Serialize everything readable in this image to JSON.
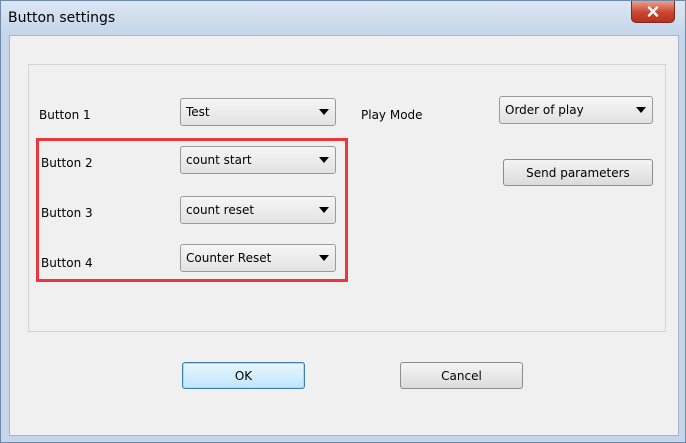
{
  "window": {
    "title": "Button settings",
    "close_label": "x"
  },
  "form": {
    "rows": [
      {
        "label": "Button 1",
        "selected": "Test"
      },
      {
        "label": "Button 2",
        "selected": "count start"
      },
      {
        "label": "Button 3",
        "selected": "count reset"
      },
      {
        "label": "Button 4",
        "selected": "Counter Reset"
      }
    ],
    "play_mode": {
      "label": "Play Mode",
      "selected": "Order of play"
    },
    "send_parameters_label": "Send parameters"
  },
  "footer": {
    "ok_label": "OK",
    "cancel_label": "Cancel"
  },
  "colors": {
    "highlight_border": "#e8383d",
    "close_button": "#c9452f",
    "default_button_border": "#3c7fb1"
  },
  "icons": {
    "close": "close-icon",
    "dropdown": "chevron-down-icon"
  }
}
